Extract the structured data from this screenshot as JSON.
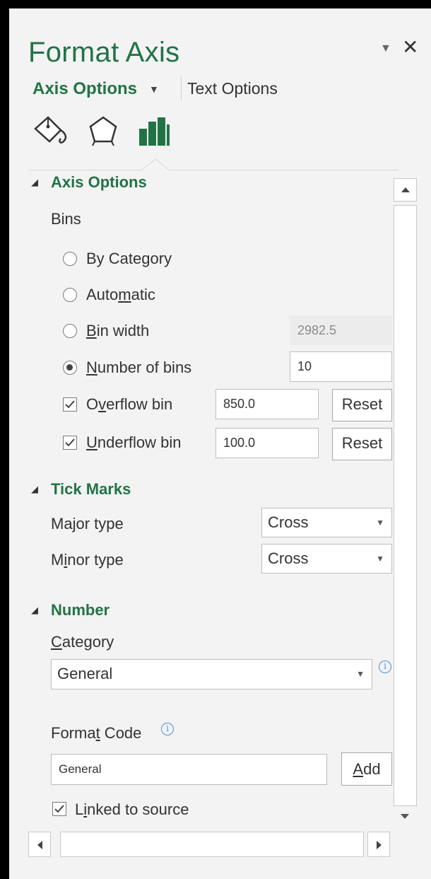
{
  "pane": {
    "title": "Format Axis",
    "dropdown_glyph": "▼",
    "close_glyph": "✕"
  },
  "tabs": {
    "axis_options": "Axis Options",
    "text_options": "Text Options"
  },
  "icons": [
    "fill-line-icon",
    "effects-icon",
    "axis-options-icon"
  ],
  "sections": {
    "axis_options": {
      "title": "Axis Options",
      "bins_label": "Bins",
      "by_category": {
        "pre": "By Cate",
        "ul": "g",
        "post": "ory"
      },
      "automatic": {
        "pre": "Auto",
        "ul": "m",
        "post": "atic"
      },
      "bin_width": {
        "pre": "",
        "ul": "B",
        "post": "in width",
        "value": "2982.5"
      },
      "number_of_bins": {
        "pre": "",
        "ul": "N",
        "post": "umber of bins",
        "value": "10"
      },
      "selected_bin_option": "number_of_bins",
      "overflow_bin": {
        "pre": "O",
        "ul": "v",
        "post": "erflow bin",
        "value": "850.0",
        "checked": true
      },
      "underflow_bin": {
        "pre": "",
        "ul": "U",
        "post": "nderflow bin",
        "value": "100.0",
        "checked": true
      },
      "reset_label": "Reset"
    },
    "tick_marks": {
      "title": "Tick Marks",
      "major_type": {
        "pre": "Ma",
        "ul": "j",
        "post": "or type",
        "value": "Cross"
      },
      "minor_type": {
        "pre": "M",
        "ul": "i",
        "post": "nor type",
        "value": "Cross"
      }
    },
    "number": {
      "title": "Number",
      "category_label": {
        "pre": "",
        "ul": "C",
        "post": "ategory"
      },
      "category_value": "General",
      "format_code_label": {
        "pre": "Forma",
        "ul": "t",
        "post": " Code"
      },
      "format_code_value": "General",
      "add_label": {
        "pre": "",
        "ul": "A",
        "post": "dd"
      },
      "linked_to_source": {
        "pre": "L",
        "ul": "i",
        "post": "nked to source",
        "checked": true
      }
    }
  },
  "colors": {
    "accent": "#217346",
    "pane_bg": "#f3f3f3",
    "info": "#4a90d9"
  }
}
